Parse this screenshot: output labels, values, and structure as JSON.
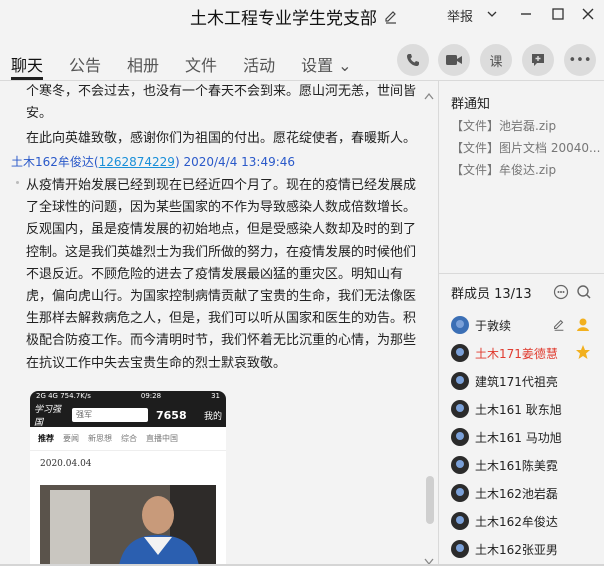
{
  "window": {
    "title": "土木工程专业学生党支部",
    "report_label": "举报",
    "minimize_glyph": "∨",
    "restore_glyph": "—",
    "maximize_glyph": "☐",
    "close_glyph": "✕"
  },
  "tabs": [
    {
      "label": "聊天",
      "active": true
    },
    {
      "label": "公告",
      "active": false
    },
    {
      "label": "相册",
      "active": false
    },
    {
      "label": "文件",
      "active": false
    },
    {
      "label": "活动",
      "active": false
    },
    {
      "label": "设置 ⌄",
      "active": false
    }
  ],
  "toolbar": {
    "phone_icon": "phone-icon",
    "video_icon": "video-icon",
    "class_label": "课",
    "chat_add_icon": "chat-plus-icon",
    "more_label": "•••"
  },
  "chat": {
    "para1": "个寒冬，不会过去，也没有一个春天不会到来。愿山河无恙，世间皆安。",
    "para2": "在此向英雄致敬，感谢你们为祖国的付出。愿花绽使者，春暖斯人。",
    "sender_name": "土木162牟俊达(",
    "sender_id": "1262874229",
    "sender_time": ") 2020/4/4 13:49:46",
    "para3": "从疫情开始发展已经到现在已经近四个月了。现在的疫情已经发展成了全球性的问题，因为某些国家的不作为导致感染人数成倍数增长。反观国内，虽是疫情发展的初始地点，但是受感染人数却及时的到了控制。这是我们英雄烈士为我们所做的努力，在疫情发展的时候他们不退反近。不顾危险的进去了疫情发展最凶猛的重灾区。明知山有虎，偏向虎山行。为国家控制病情贡献了宝贵的生命，我们无法像医生那样去解救病危之人，但是，我们可以听从国家和医生的劝告。积极配合防疫工作。而今清明时节，我们怀着无比沉重的心情，为那些在抗议工作中失去宝贵生命的烈士默哀致敬。",
    "phone": {
      "status_left": "2G 4G 754.7K/s",
      "status_time": "09:28",
      "status_right": "31",
      "logo": "学习强国",
      "search": "强军",
      "score": "7658",
      "mine": "我的",
      "nav": [
        "推荐",
        "要闻",
        "新思想",
        "综合",
        "直播中国"
      ],
      "date": "2020.04.04"
    }
  },
  "notice": {
    "title": "群通知",
    "files": [
      "【文件】池岩磊.zip",
      "【文件】图片文档 20040...",
      "【文件】牟俊达.zip"
    ]
  },
  "members": {
    "title": "群成员 13/13",
    "list": [
      {
        "name": "于敦续",
        "red": false
      },
      {
        "name": "土木171姜德慧",
        "red": true
      },
      {
        "name": "建筑171代祖亮",
        "red": false
      },
      {
        "name": "土木161  耿东旭",
        "red": false
      },
      {
        "name": "土木161 马功旭",
        "red": false
      },
      {
        "name": "土木161陈美霓",
        "red": false
      },
      {
        "name": "土木162池岩磊",
        "red": false
      },
      {
        "name": "土木162牟俊达",
        "red": false
      },
      {
        "name": "土木162张亚男",
        "red": false
      }
    ]
  },
  "colors": {
    "accent_blue": "#2a59c9",
    "owner_red": "#e03b2f",
    "crown_gold": "#f2b01e"
  }
}
